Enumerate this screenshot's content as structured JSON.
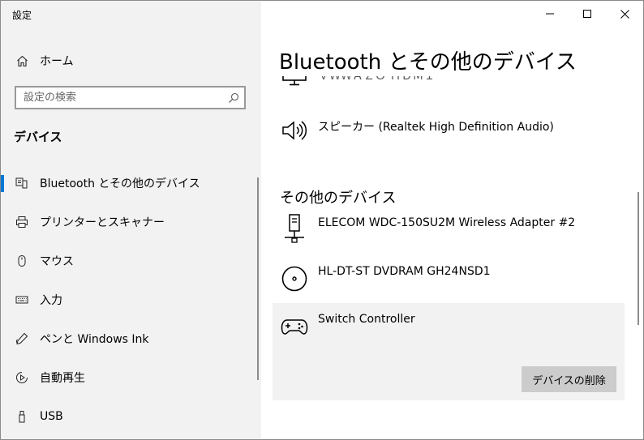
{
  "window": {
    "title": "設定"
  },
  "sidebar": {
    "home_label": "ホーム",
    "search_placeholder": "設定の検索",
    "section_title": "デバイス",
    "items": [
      {
        "label": "Bluetooth とその他のデバイス",
        "icon": "bluetooth-devices-icon",
        "selected": true
      },
      {
        "label": "プリンターとスキャナー",
        "icon": "printer-icon"
      },
      {
        "label": "マウス",
        "icon": "mouse-icon"
      },
      {
        "label": "入力",
        "icon": "keyboard-icon"
      },
      {
        "label": "ペンと Windows Ink",
        "icon": "pen-icon"
      },
      {
        "label": "自動再生",
        "icon": "autoplay-icon"
      },
      {
        "label": "USB",
        "icon": "usb-icon"
      }
    ]
  },
  "main": {
    "title": "Bluetooth とその他のデバイス",
    "audio_devices": [
      {
        "name": "ＶＷＷＡＺＯ ＨＤＭＩ",
        "icon": "monitor-icon"
      },
      {
        "name": "スピーカー (Realtek High Definition Audio)",
        "icon": "speaker-icon"
      }
    ],
    "other_devices_header": "その他のデバイス",
    "other_devices": [
      {
        "name": "ELECOM WDC-150SU2M Wireless Adapter #2",
        "icon": "network-adapter-icon"
      },
      {
        "name": "HL-DT-ST DVDRAM GH24NSD1",
        "icon": "disc-drive-icon"
      },
      {
        "name": "Switch Controller",
        "icon": "gamepad-icon",
        "selected": true
      }
    ],
    "remove_button_label": "デバイスの削除"
  },
  "colors": {
    "accent": "#0078d7",
    "sidebar_bg": "#f2f2f2",
    "selected_bg": "#f2f2f2",
    "button_bg": "#cccccc"
  }
}
